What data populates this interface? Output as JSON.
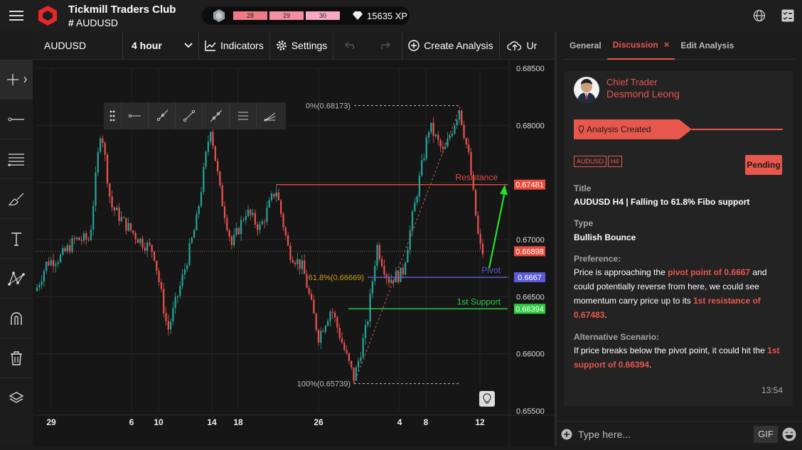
{
  "app": {
    "club_name": "Tickmill Traders Club",
    "channel": "AUDUSD"
  },
  "levels": {
    "items": [
      "28",
      "29",
      "30"
    ],
    "colors": [
      "#f07a86",
      "#f48fa0",
      "#f7a8c6"
    ],
    "xp": "15635 XP"
  },
  "toolbar": {
    "symbol": "AUDUSD",
    "timeframe": "4 hour",
    "indicators": "Indicators",
    "settings": "Settings",
    "create_analysis": "Create Analysis",
    "upload_partial": "Ur"
  },
  "chart_data": {
    "type": "candlestick",
    "y_ticks": [
      "0.68500",
      "0.68000",
      "0.67500",
      "0.67000",
      "0.66500",
      "0.66000",
      "0.65500"
    ],
    "ylim": [
      0.655,
      0.685
    ],
    "x_ticks": [
      "29",
      "6",
      "10",
      "14",
      "18",
      "26",
      "4",
      "8",
      "12"
    ],
    "price_tags": [
      {
        "label": "0.67481",
        "value": 0.67481,
        "color": "#e74c3c"
      },
      {
        "label": "0.66898",
        "value": 0.66898,
        "color": "#e74c3c"
      },
      {
        "label": "0.6667",
        "value": 0.6667,
        "color": "#5b5bd6"
      },
      {
        "label": "0.66394",
        "value": 0.66394,
        "color": "#2ecc40"
      }
    ],
    "lines": [
      {
        "label": "Resistance",
        "value": 0.67481,
        "color": "#e74c3c"
      },
      {
        "label": "Pivot",
        "value": 0.6667,
        "color": "#5b5bd6"
      },
      {
        "label": "1st Support",
        "value": 0.66394,
        "color": "#2ecc40"
      }
    ],
    "fib": [
      {
        "label": "0%(0.68173)",
        "value": 0.68173
      },
      {
        "label": "61.8%(0.66669)",
        "value": 0.66669
      },
      {
        "label": "100%(0.65739)",
        "value": 0.65739
      }
    ]
  },
  "panel": {
    "tabs": [
      "General",
      "Discussion",
      "Edit Analysis"
    ],
    "author_role": "Chief Trader",
    "author_name": "Desmond Leong",
    "status_banner": "Analysis Created",
    "symbol_badge": "AUDUSD",
    "tf_badge": "H4",
    "status": "Pending",
    "title_label": "Title",
    "title_value": "AUDUSD H4 | Falling to 61.8% Fibo support",
    "type_label": "Type",
    "type_value": "Bullish Bounce",
    "pref_label": "Preference:",
    "pref_t1": "Price is approaching the ",
    "pref_h1": "pivot point of 0.6667",
    "pref_t2": " and could potentially reverse from here, we could see momentum carry price up to its ",
    "pref_h2": "1st resistance of 0.67483",
    "pref_t3": ".",
    "alt_label": "Alternative Scenario:",
    "alt_t1": "If price breaks below the pivot point, it could hit the ",
    "alt_h1": "1st support of 0.66394",
    "alt_t2": ".",
    "time": "13:54",
    "composer_placeholder": "Type here...",
    "gif": "GIF"
  }
}
